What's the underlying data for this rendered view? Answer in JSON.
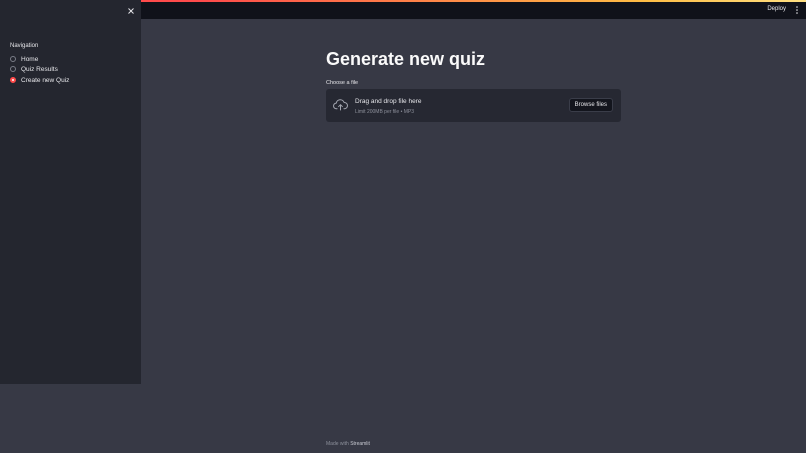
{
  "header": {
    "deploy_label": "Deploy",
    "menu_icon": "kebab-menu-icon",
    "accent_colors": [
      "#ff4b4b",
      "#ffbd45",
      "#ffe082"
    ]
  },
  "sidebar": {
    "close_icon": "close-icon",
    "nav_title": "Navigation",
    "items": [
      {
        "label": "Home",
        "selected": false
      },
      {
        "label": "Quiz Results",
        "selected": false
      },
      {
        "label": "Create new Quiz",
        "selected": true
      }
    ],
    "selected_color": "#ff4b4b"
  },
  "main": {
    "title": "Generate new quiz",
    "uploader": {
      "label": "Choose a file",
      "icon": "cloud-upload-icon",
      "drop_text": "Drag and drop file here",
      "limit_text": "Limit 200MB per file • MP3",
      "browse_label": "Browse files"
    }
  },
  "footer": {
    "prefix": "Made with",
    "brand": "Streamlit"
  }
}
